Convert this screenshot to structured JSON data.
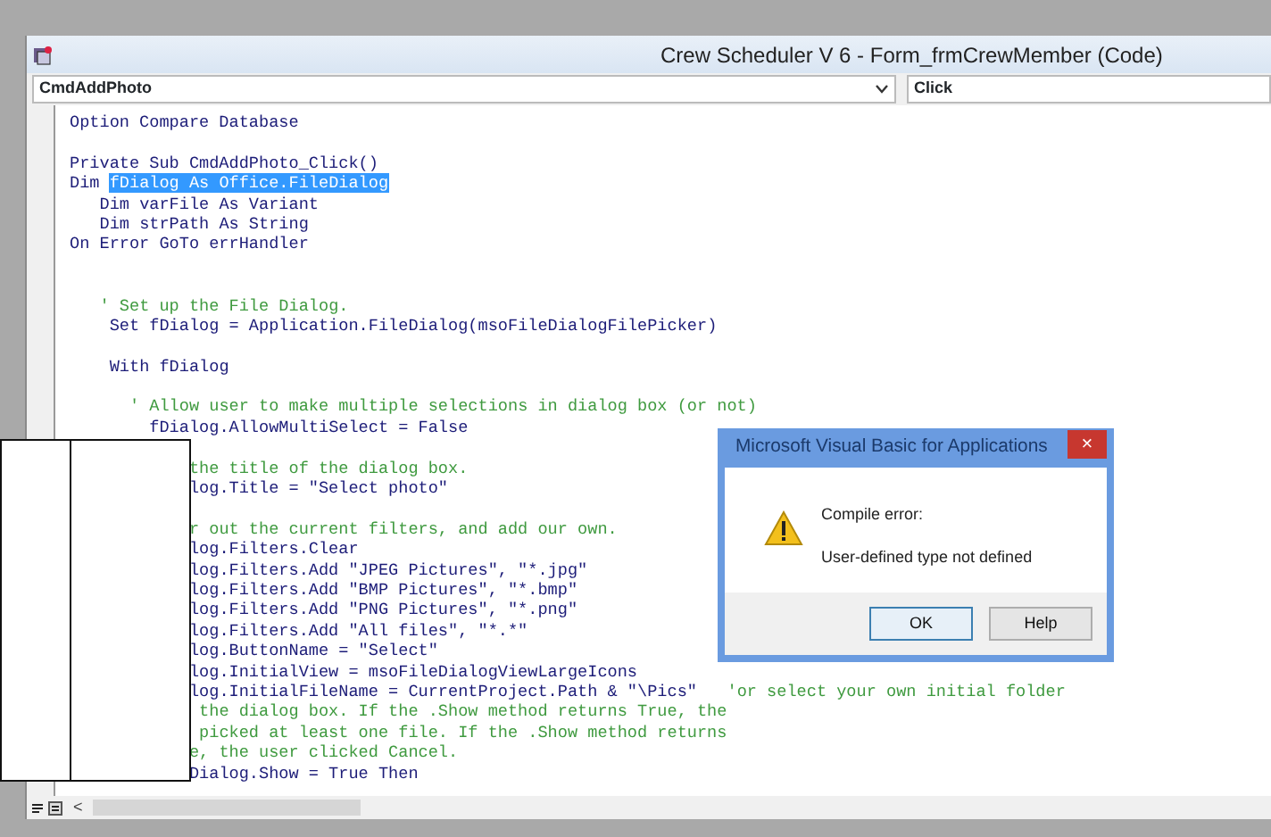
{
  "window": {
    "title": "Crew Scheduler V 6 - Form_frmCrewMember (Code)"
  },
  "object_combo": {
    "value": "CmdAddPhoto"
  },
  "procedure_combo": {
    "value": "Click"
  },
  "code_lines": [
    {
      "kind": "code",
      "segments": [
        {
          "kind": "code",
          "text": "Option Compare Database"
        }
      ]
    },
    {
      "kind": "blank"
    },
    {
      "kind": "code",
      "segments": [
        {
          "kind": "code",
          "text": "Private Sub CmdAddPhoto_Click()"
        }
      ]
    },
    {
      "kind": "code",
      "segments": [
        {
          "kind": "code",
          "text": "Dim "
        },
        {
          "kind": "selection",
          "text": "fDialog As Office.FileDialog"
        }
      ]
    },
    {
      "kind": "code",
      "segments": [
        {
          "kind": "code",
          "text": "   Dim varFile As Variant"
        }
      ]
    },
    {
      "kind": "code",
      "segments": [
        {
          "kind": "code",
          "text": "   Dim strPath As String"
        }
      ]
    },
    {
      "kind": "code",
      "segments": [
        {
          "kind": "code",
          "text": "On Error GoTo errHandler"
        }
      ]
    },
    {
      "kind": "blank"
    },
    {
      "kind": "blank"
    },
    {
      "kind": "code",
      "segments": [
        {
          "kind": "comment",
          "text": "   ' Set up the File Dialog."
        }
      ]
    },
    {
      "kind": "code",
      "segments": [
        {
          "kind": "code",
          "text": "    Set fDialog = Application.FileDialog(msoFileDialogFilePicker)"
        }
      ]
    },
    {
      "kind": "blank"
    },
    {
      "kind": "code",
      "segments": [
        {
          "kind": "code",
          "text": "    With fDialog"
        }
      ]
    },
    {
      "kind": "blank"
    },
    {
      "kind": "code",
      "segments": [
        {
          "kind": "comment",
          "text": "      ' Allow user to make multiple selections in dialog box (or not)"
        }
      ]
    },
    {
      "kind": "code",
      "segments": [
        {
          "kind": "code",
          "text": "        fDialog.AllowMultiSelect = False"
        }
      ]
    },
    {
      "kind": "blank"
    },
    {
      "kind": "code",
      "segments": [
        {
          "kind": "comment",
          "text": "            the title of the dialog box."
        }
      ]
    },
    {
      "kind": "code",
      "segments": [
        {
          "kind": "code",
          "text": "            log.Title = \"Select photo\""
        }
      ]
    },
    {
      "kind": "blank"
    },
    {
      "kind": "code",
      "segments": [
        {
          "kind": "comment",
          "text": "            r out the current filters, and add our own."
        }
      ]
    },
    {
      "kind": "code",
      "segments": [
        {
          "kind": "code",
          "text": "            log.Filters.Clear"
        }
      ]
    },
    {
      "kind": "code",
      "segments": [
        {
          "kind": "code",
          "text": "            log.Filters.Add \"JPEG Pictures\", \"*.jpg\""
        }
      ]
    },
    {
      "kind": "code",
      "segments": [
        {
          "kind": "code",
          "text": "            log.Filters.Add \"BMP Pictures\", \"*.bmp\""
        }
      ]
    },
    {
      "kind": "code",
      "segments": [
        {
          "kind": "code",
          "text": "            log.Filters.Add \"PNG Pictures\", \"*.png\""
        }
      ]
    },
    {
      "kind": "code",
      "segments": [
        {
          "kind": "code",
          "text": "            log.Filters.Add \"All files\", \"*.*\""
        }
      ]
    },
    {
      "kind": "code",
      "segments": [
        {
          "kind": "code",
          "text": "            log.ButtonName = \"Select\""
        }
      ]
    },
    {
      "kind": "code",
      "segments": [
        {
          "kind": "code",
          "text": "            log.InitialView = msoFileDialogViewLargeIcons"
        }
      ]
    },
    {
      "kind": "code",
      "segments": [
        {
          "kind": "code",
          "text": "            log.InitialFileName = CurrentProject.Path & \"\\Pics\""
        },
        {
          "kind": "comment",
          "text": "   'or select your own initial folder"
        }
      ]
    },
    {
      "kind": "code",
      "segments": [
        {
          "kind": "comment",
          "text": "             the dialog box. If the .Show method returns True, the"
        }
      ]
    },
    {
      "kind": "code",
      "segments": [
        {
          "kind": "comment",
          "text": "             picked at least one file. If the .Show method returns"
        }
      ]
    },
    {
      "kind": "code",
      "segments": [
        {
          "kind": "comment",
          "text": "            e, the user clicked Cancel."
        }
      ]
    },
    {
      "kind": "code",
      "segments": [
        {
          "kind": "code",
          "text": "            Dialog.Show = True Then"
        }
      ]
    }
  ],
  "scroll_left_label": "<",
  "dialog": {
    "title": "Microsoft Visual Basic for Applications",
    "close_label": "×",
    "heading": "Compile error:",
    "message": "User-defined type not defined",
    "buttons": [
      {
        "label": "OK",
        "selected": true
      },
      {
        "label": "Help",
        "selected": false
      }
    ]
  }
}
